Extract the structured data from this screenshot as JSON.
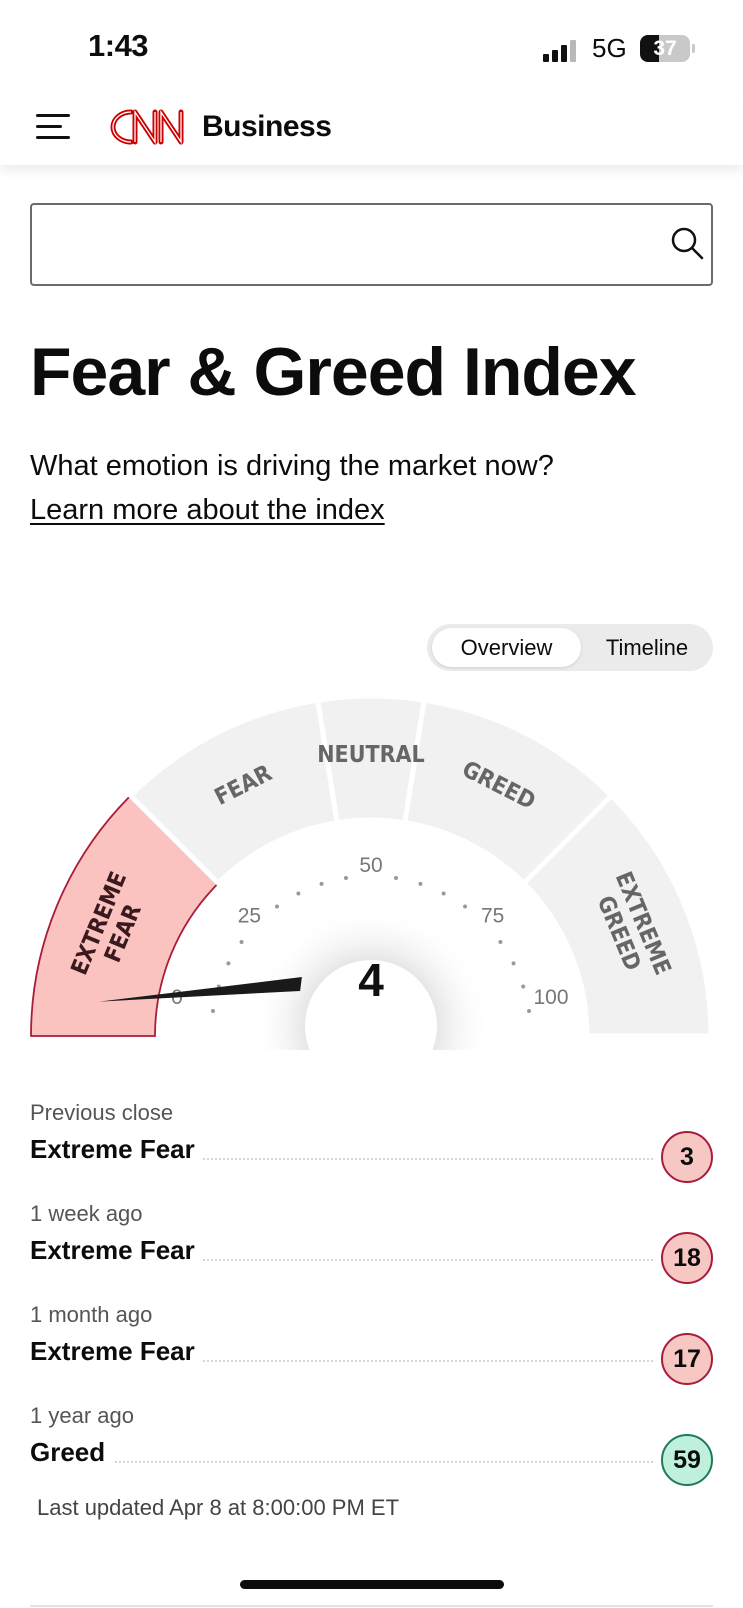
{
  "status_bar": {
    "time": "1:43",
    "network": "5G",
    "battery": "37",
    "battery_level": 0.37
  },
  "header": {
    "logo_text": "CNN",
    "brand": "Business"
  },
  "search": {
    "value": "",
    "placeholder": ""
  },
  "page": {
    "title": "Fear & Greed Index",
    "subtitle": "What emotion is driving the market now?",
    "learn_more": "Learn more about the index"
  },
  "toggle": {
    "options": [
      "Overview",
      "Timeline"
    ],
    "selected": "Overview"
  },
  "gauge": {
    "value": 4,
    "value_display": "4",
    "scale_min": 0,
    "scale_max": 100,
    "ticks": [
      "0",
      "25",
      "50",
      "75",
      "100"
    ],
    "zones": [
      {
        "label": [
          "EXTREME",
          "FEAR"
        ],
        "from": 0,
        "to": 25
      },
      {
        "label": [
          "FEAR"
        ],
        "from": 25,
        "to": 45
      },
      {
        "label": [
          "NEUTRAL"
        ],
        "from": 45,
        "to": 55
      },
      {
        "label": [
          "GREED"
        ],
        "from": 55,
        "to": 75
      },
      {
        "label": [
          "EXTREME",
          "GREED"
        ],
        "from": 75,
        "to": 100
      }
    ],
    "active_zone": 0,
    "colors": {
      "zone": "#f1f1f1",
      "active_zone": "#fbc3bf",
      "active_border": "#a81d3a",
      "zone_text": "#666666",
      "active_text": "#3a1a1f",
      "needle": "#1a1a1a"
    }
  },
  "history": [
    {
      "period": "Previous close",
      "label": "Extreme Fear",
      "value": "3",
      "sentiment": "fear"
    },
    {
      "period": "1 week ago",
      "label": "Extreme Fear",
      "value": "18",
      "sentiment": "fear"
    },
    {
      "period": "1 month ago",
      "label": "Extreme Fear",
      "value": "17",
      "sentiment": "fear"
    },
    {
      "period": "1 year ago",
      "label": "Greed",
      "value": "59",
      "sentiment": "greed"
    }
  ],
  "last_updated": "Last updated Apr 8 at 8:00:00 PM ET"
}
